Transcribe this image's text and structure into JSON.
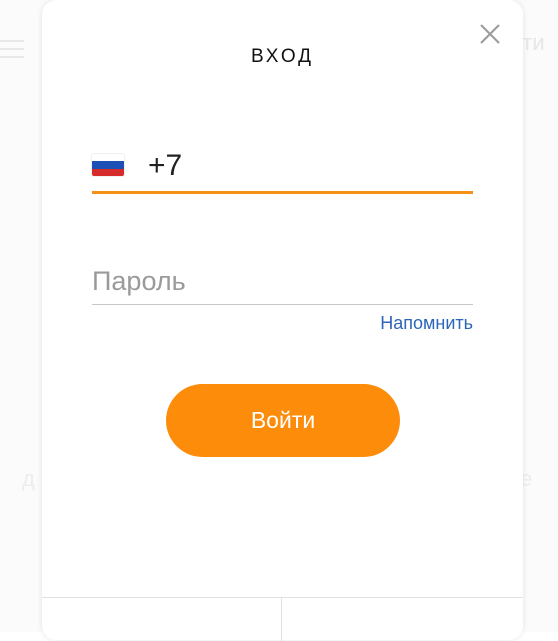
{
  "background": {
    "login_text": "йти",
    "left_char": "д",
    "right_char": "е"
  },
  "modal": {
    "title": "ВХОД",
    "close_icon": "close-icon"
  },
  "phone": {
    "country_flag": "russia-flag-icon",
    "value": "+7"
  },
  "password": {
    "placeholder": "Пароль",
    "value": ""
  },
  "remind_link": "Напомнить",
  "login_button": "Войти",
  "colors": {
    "accent": "#fd8c0b",
    "active_underline": "#f39215",
    "link": "#2c66b8"
  }
}
